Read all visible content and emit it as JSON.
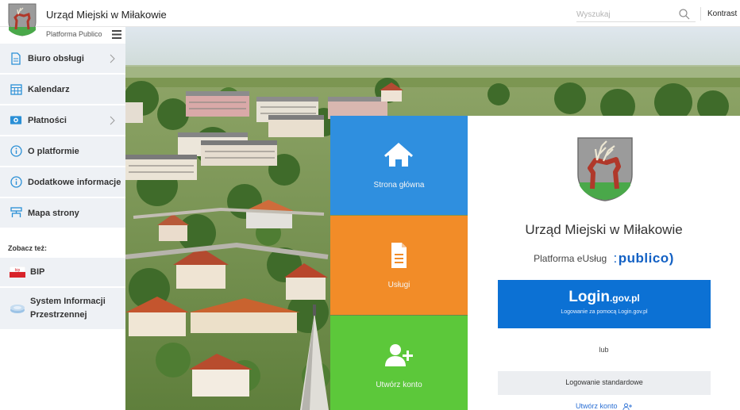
{
  "header": {
    "title": "Urząd Miejski w Miłakowie",
    "search_placeholder": "Wyszukaj",
    "search_value": "",
    "contrast_label": "Kontrast"
  },
  "sidebar": {
    "platform_label": "Platforma Publico",
    "items": [
      {
        "label": "Biuro obsługi",
        "icon": "document-icon",
        "has_submenu": true
      },
      {
        "label": "Kalendarz",
        "icon": "calendar-icon",
        "has_submenu": false
      },
      {
        "label": "Płatności",
        "icon": "payment-icon",
        "has_submenu": true
      },
      {
        "label": "O platformie",
        "icon": "info-icon",
        "has_submenu": false
      },
      {
        "label": "Dodatkowe informacje",
        "icon": "info-icon",
        "has_submenu": false
      },
      {
        "label": "Mapa strony",
        "icon": "sitemap-icon",
        "has_submenu": false
      }
    ],
    "see_also_label": "Zobacz też:",
    "external": [
      {
        "label": "BIP",
        "icon": "bip-flag-icon"
      },
      {
        "label": "System Informacji Przestrzennej",
        "icon": "map-layers-icon"
      }
    ]
  },
  "tiles": {
    "home": {
      "label": "Strona główna",
      "icon": "home-icon"
    },
    "services": {
      "label": "Usługi",
      "icon": "file-icon"
    },
    "register": {
      "label": "Utwórz konto",
      "icon": "add-user-icon"
    }
  },
  "panel": {
    "org_name": "Urząd Miejski w Miłakowie",
    "platform_text": "Platforma eUsług",
    "publico_logo": "publico)",
    "login_gov_big": "Login",
    "login_gov_small": ".gov.pl",
    "login_gov_subtitle": "Logowanie za pomocą Login.gov.pl",
    "or_text": "lub",
    "standard_login": "Logowanie standardowe",
    "create_account": "Utwórz konto"
  },
  "colors": {
    "tile_home": "#2f8fdf",
    "tile_services": "#f28c28",
    "tile_register": "#5cc83a",
    "login_gov": "#0c71d4",
    "sidebar_bg": "#eef1f5",
    "sidebar_icon": "#2a8fd6"
  }
}
